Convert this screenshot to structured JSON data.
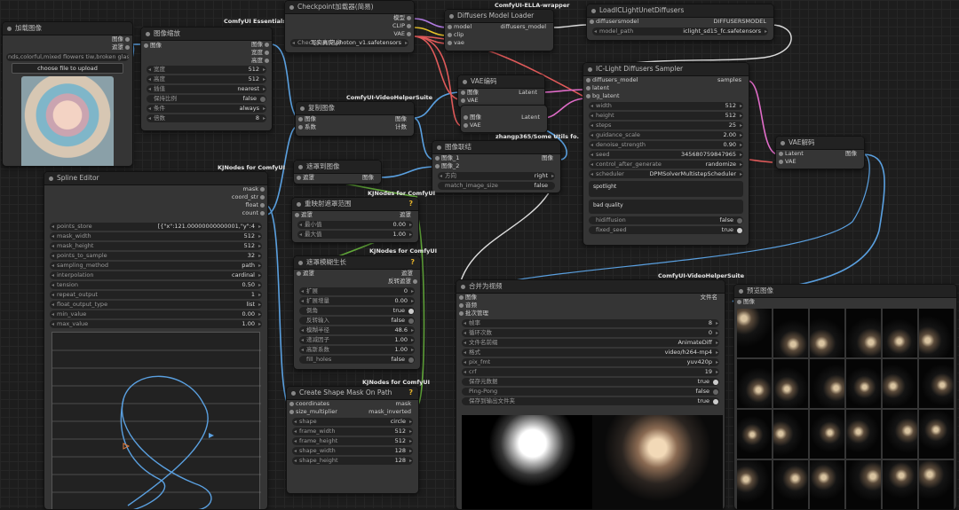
{
  "load_image": {
    "title": "加载图像",
    "out_image": "图像",
    "out_mask": "遮罩",
    "filename": "nds,colorful,mixed flowers tiw,broken glass,(br (3).png",
    "upload_button": "choose file to upload"
  },
  "resize": {
    "badge": "ComfyUI Essentials",
    "title": "图像缩放",
    "in_image": "图像",
    "out_image": "图像",
    "out_width": "宽度",
    "out_height": "高度",
    "widgets": [
      {
        "label": "宽度",
        "value": "512"
      },
      {
        "label": "高度",
        "value": "512"
      },
      {
        "label": "插值",
        "value": "nearest"
      },
      {
        "label": "保持比例",
        "value": "false"
      },
      {
        "label": "条件",
        "value": "always"
      },
      {
        "label": "倍数",
        "value": "8"
      }
    ]
  },
  "checkpoint": {
    "title": "Checkpoint加载器(简易)",
    "out_model": "模型",
    "out_clip": "CLIP",
    "out_vae": "VAE",
    "ckpt_label": "Checkpoint名称",
    "ckpt_value": "写实真实\\photon_v1.safetensors"
  },
  "diffusers_loader": {
    "badge": "ComfyUI-ELLA-wrapper",
    "title": "Diffusers Model Loader",
    "in_model": "model",
    "in_clip": "clip",
    "in_vae": "vae",
    "out": "diffusers_model"
  },
  "iclight_load": {
    "title": "LoadICLightUnetDiffusers",
    "in": "diffusersmodel",
    "out": "DIFFUSERSMODEL",
    "model_path_label": "model_path",
    "model_path_value": "iclight_sd15_fc.safetensors"
  },
  "vae_encode_top": {
    "title": "VAE编码",
    "in_image": "图像",
    "in_vae": "VAE",
    "out": "Latent"
  },
  "vae_encode_mid": {
    "in_image": "图像",
    "in_vae": "VAE",
    "out": "Latent"
  },
  "sampler": {
    "title": "IC-Light Diffusers Sampler",
    "in_model": "diffusers_model",
    "in_latent": "latent",
    "in_bg": "bg_latent",
    "out": "samples",
    "widgets": [
      {
        "label": "width",
        "value": "512"
      },
      {
        "label": "height",
        "value": "512"
      },
      {
        "label": "steps",
        "value": "25"
      },
      {
        "label": "guidance_scale",
        "value": "2.00"
      },
      {
        "label": "denoise_strength",
        "value": "0.90"
      },
      {
        "label": "seed",
        "value": "345680759847965"
      },
      {
        "label": "control_after_generate",
        "value": "randomize"
      },
      {
        "label": "scheduler",
        "value": "DPMSolverMultistepScheduler"
      }
    ],
    "prompt": "spotlight",
    "negative": "bad quality",
    "toggles": [
      {
        "label": "hidiffusion",
        "value": "false"
      },
      {
        "label": "fixed_seed",
        "value": "true"
      }
    ]
  },
  "vae_decode": {
    "title": "VAE解码",
    "in_latent": "Latent",
    "in_vae": "VAE",
    "out": "图像"
  },
  "video_helper1": {
    "badge": "ComfyUI-VideoHelperSuite",
    "title": "复制图像",
    "in_image": "图像",
    "in_count": "系数",
    "out_image": "图像",
    "out_count": "计数"
  },
  "invert_mask": {
    "title": "遮罩到图像",
    "in": "遮罩",
    "out": "图像"
  },
  "image_concat": {
    "badge": "zhangp365/Some Utils fo.",
    "title": "图像联结",
    "in1": "图像_1",
    "in2": "图像_2",
    "out": "图像",
    "dir_label": "方向",
    "dir_value": "right",
    "match_label": "match_image_size",
    "match_value": "false"
  },
  "spline": {
    "badge": "KJNodes for ComfyUI",
    "title": "Spline Editor",
    "outs": [
      "mask",
      "coord_str",
      "float",
      "count"
    ],
    "widgets": [
      {
        "label": "points_store",
        "value": "[{\"x\":121.00000000000001,\"y\":4"
      },
      {
        "label": "mask_width",
        "value": "512"
      },
      {
        "label": "mask_height",
        "value": "512"
      },
      {
        "label": "points_to_sample",
        "value": "32"
      },
      {
        "label": "sampling_method",
        "value": "path"
      },
      {
        "label": "interpolation",
        "value": "cardinal"
      },
      {
        "label": "tension",
        "value": "0.50"
      },
      {
        "label": "repeat_output",
        "value": "1"
      },
      {
        "label": "float_output_type",
        "value": "list"
      },
      {
        "label": "min_value",
        "value": "0.00"
      },
      {
        "label": "max_value",
        "value": "1.00"
      }
    ]
  },
  "remap": {
    "badge": "KJNodes for ComfyUI",
    "title": "重映射遮罩范围",
    "in": "遮罩",
    "out": "遮罩",
    "widgets": [
      {
        "label": "最小值",
        "value": "0.00"
      },
      {
        "label": "最大值",
        "value": "1.00"
      }
    ]
  },
  "grow_mask": {
    "badge": "KJNodes for ComfyUI",
    "title": "遮罩模糊生长",
    "in": "遮罩",
    "out1": "遮罩",
    "out2": "反转遮罩",
    "widgets": [
      {
        "label": "扩展",
        "value": "0"
      },
      {
        "label": "扩展增量",
        "value": "0.00"
      },
      {
        "label": "倒角",
        "value": "true"
      },
      {
        "label": "反转输入",
        "value": "false"
      },
      {
        "label": "模糊半径",
        "value": "48.6"
      },
      {
        "label": "递减因子",
        "value": "1.00"
      },
      {
        "label": "高斯系数",
        "value": "1.00"
      },
      {
        "label": "fill_holes",
        "value": "false"
      }
    ]
  },
  "shape_mask": {
    "badge": "KJNodes for ComfyUI",
    "title": "Create Shape Mask On Path",
    "in1": "coordinates",
    "in2": "size_multiplier",
    "out1": "mask",
    "out2": "mask_inverted",
    "widgets": [
      {
        "label": "shape",
        "value": "circle"
      },
      {
        "label": "frame_width",
        "value": "512"
      },
      {
        "label": "frame_height",
        "value": "512"
      },
      {
        "label": "shape_width",
        "value": "128"
      },
      {
        "label": "shape_height",
        "value": "128"
      }
    ]
  },
  "combine": {
    "badge": "ComfyUI-VideoHelperSuite",
    "title": "合并为视频",
    "ins": [
      "图像",
      "音频",
      "批次管理"
    ],
    "out": "文件名",
    "widgets": [
      {
        "label": "帧率",
        "value": "8"
      },
      {
        "label": "循环次数",
        "value": "0"
      },
      {
        "label": "文件名前缀",
        "value": "AnimateDiff"
      },
      {
        "label": "格式",
        "value": "video/h264-mp4"
      },
      {
        "label": "pix_fmt",
        "value": "yuv420p"
      },
      {
        "label": "crf",
        "value": "19"
      },
      {
        "label": "保存元数据",
        "value": "true"
      },
      {
        "label": "Ping-Pong",
        "value": "false"
      },
      {
        "label": "保存到输出文件夹",
        "value": "true"
      }
    ]
  },
  "preview": {
    "title": "预览图像",
    "in": "图像"
  },
  "colors": {
    "image_link": "#5aa0e0",
    "mask_link": "#62a83a",
    "model_link": "#b07ae0",
    "vae_link": "#e05a5a",
    "latent_link": "#e06cc8",
    "yellow_link": "#e6c229",
    "white_link": "#dddddd"
  }
}
